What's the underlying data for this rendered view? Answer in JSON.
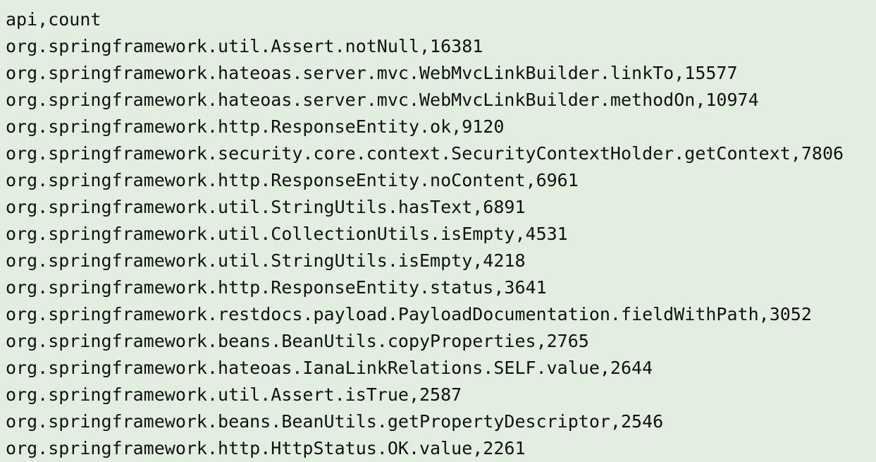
{
  "lines": [
    "api,count",
    "org.springframework.util.Assert.notNull,16381",
    "org.springframework.hateoas.server.mvc.WebMvcLinkBuilder.linkTo,15577",
    "org.springframework.hateoas.server.mvc.WebMvcLinkBuilder.methodOn,10974",
    "org.springframework.http.ResponseEntity.ok,9120",
    "org.springframework.security.core.context.SecurityContextHolder.getContext,7806",
    "org.springframework.http.ResponseEntity.noContent,6961",
    "org.springframework.util.StringUtils.hasText,6891",
    "org.springframework.util.CollectionUtils.isEmpty,4531",
    "org.springframework.util.StringUtils.isEmpty,4218",
    "org.springframework.http.ResponseEntity.status,3641",
    "org.springframework.restdocs.payload.PayloadDocumentation.fieldWithPath,3052",
    "org.springframework.beans.BeanUtils.copyProperties,2765",
    "org.springframework.hateoas.IanaLinkRelations.SELF.value,2644",
    "org.springframework.util.Assert.isTrue,2587",
    "org.springframework.beans.BeanUtils.getPropertyDescriptor,2546",
    "org.springframework.http.HttpStatus.OK.value,2261"
  ],
  "colors": {
    "background": "#e2efe0",
    "text": "#111111"
  }
}
